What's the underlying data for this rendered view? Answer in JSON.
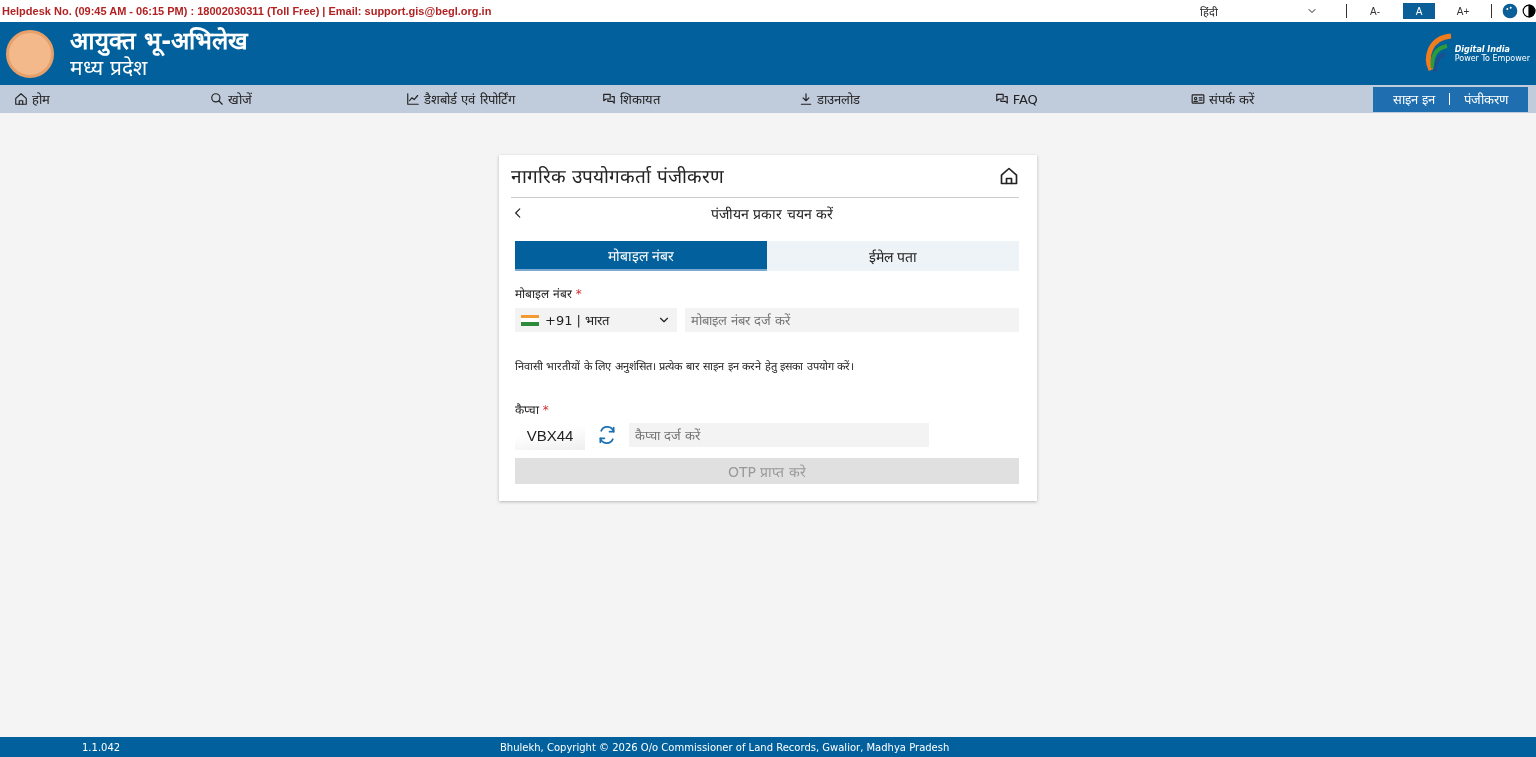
{
  "top_bar": {
    "helpdesk": "Helpdesk No. (09:45 AM - 06:15 PM) : 18002030311 (Toll Free) | Email: support.gis@begl.org.in",
    "language": "हिंदी",
    "font_sizes": [
      {
        "label": "A-",
        "selected": false
      },
      {
        "label": "A",
        "selected": true
      },
      {
        "label": "A+",
        "selected": false
      }
    ]
  },
  "header": {
    "title": "आयुक्त भू-अभिलेख",
    "subtitle": "मध्य प्रदेश",
    "logo_title": "Digital India",
    "logo_tagline": "Power To Empower"
  },
  "nav": {
    "items": [
      {
        "label": "होम"
      },
      {
        "label": "खोजें"
      },
      {
        "label": "डैशबोर्ड एवं रिपोर्टिंग"
      },
      {
        "label": "शिकायत"
      },
      {
        "label": "डाउनलोड"
      },
      {
        "label": "FAQ"
      },
      {
        "label": "संपर्क करें"
      }
    ],
    "auth": [
      {
        "label": "साइन इन"
      },
      {
        "label": "पंजीकरण"
      }
    ]
  },
  "card": {
    "title": "नागरिक उपयोगकर्ता पंजीकरण",
    "subtitle": "पंजीयन प्रकार चयन करें",
    "tabs": [
      {
        "label": "मोबाइल नंबर",
        "selected": true
      },
      {
        "label": "ईमेल पता",
        "selected": false
      }
    ],
    "mobile": {
      "label": "मोबाइल नंबर",
      "required_mark": "*",
      "country": "+91 | भारत",
      "placeholder": "मोबाइल नंबर दर्ज करें"
    },
    "note": "निवासी भारतीयों के लिए अनुशंसित। प्रत्येक बार साइन इन करने हेतु इसका उपयोग करें।",
    "captcha": {
      "label": "कैप्चा",
      "required_mark": "*",
      "code": "VBX44",
      "placeholder": "कैप्चा दर्ज करें"
    },
    "submit": {
      "label": "OTP प्राप्त करे",
      "disabled": true
    }
  },
  "footer": {
    "version": "1.1.042",
    "copyright": "Bhulekh, Copyright © 2026 O/o Commissioner of Land Records, Gwalior, Madhya Pradesh"
  }
}
